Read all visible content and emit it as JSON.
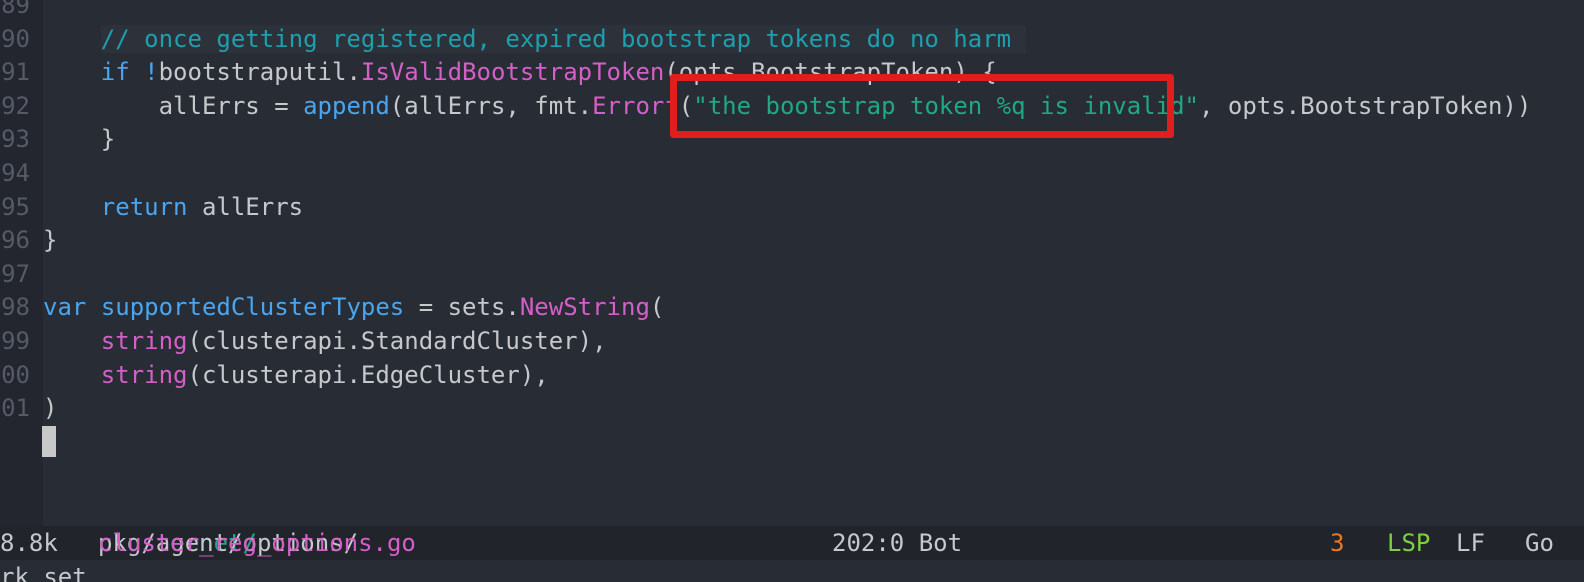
{
  "editor": {
    "lines": [
      {
        "num": "89",
        "tokens": []
      },
      {
        "num": "90",
        "tokens": [
          {
            "t": "    ",
            "c": "pl"
          },
          {
            "t": "// once getting registered, expired bootstrap tokens do no harm ",
            "c": "cm"
          }
        ]
      },
      {
        "num": "91",
        "tokens": [
          {
            "t": "    ",
            "c": "pl"
          },
          {
            "t": "if",
            "c": "kw"
          },
          {
            "t": " ",
            "c": "pl"
          },
          {
            "t": "!",
            "c": "op"
          },
          {
            "t": "bootstraputil.",
            "c": "pl"
          },
          {
            "t": "IsValidBootstrapToken",
            "c": "fn"
          },
          {
            "t": "(opts.BootstrapToken) {",
            "c": "pl"
          }
        ]
      },
      {
        "num": "92",
        "tokens": [
          {
            "t": "        allErrs = ",
            "c": "pl"
          },
          {
            "t": "append",
            "c": "kw"
          },
          {
            "t": "(allErrs, fmt.",
            "c": "pl"
          },
          {
            "t": "Errorf",
            "c": "fn"
          },
          {
            "t": "(",
            "c": "pl"
          },
          {
            "t": "\"the bootstrap token %q is invalid\"",
            "c": "str"
          },
          {
            "t": ", opts.BootstrapToken))",
            "c": "pl"
          }
        ]
      },
      {
        "num": "93",
        "tokens": [
          {
            "t": "    }",
            "c": "pl"
          }
        ]
      },
      {
        "num": "94",
        "tokens": []
      },
      {
        "num": "95",
        "tokens": [
          {
            "t": "    ",
            "c": "pl"
          },
          {
            "t": "return",
            "c": "kw"
          },
          {
            "t": " allErrs",
            "c": "pl"
          }
        ]
      },
      {
        "num": "96",
        "tokens": [
          {
            "t": "}",
            "c": "pl"
          }
        ]
      },
      {
        "num": "97",
        "tokens": []
      },
      {
        "num": "98",
        "tokens": [
          {
            "t": "var",
            "c": "kw"
          },
          {
            "t": " ",
            "c": "pl"
          },
          {
            "t": "supportedClusterTypes",
            "c": "kw"
          },
          {
            "t": " = sets.",
            "c": "pl"
          },
          {
            "t": "NewString",
            "c": "fn"
          },
          {
            "t": "(",
            "c": "pl"
          }
        ]
      },
      {
        "num": "99",
        "tokens": [
          {
            "t": "    ",
            "c": "pl"
          },
          {
            "t": "string",
            "c": "fn"
          },
          {
            "t": "(clusterapi.StandardCluster),",
            "c": "pl"
          }
        ]
      },
      {
        "num": "00",
        "tokens": [
          {
            "t": "    ",
            "c": "pl"
          },
          {
            "t": "string",
            "c": "fn"
          },
          {
            "t": "(clusterapi.EdgeCluster),",
            "c": "pl"
          }
        ]
      },
      {
        "num": "01",
        "tokens": [
          {
            "t": ")",
            "c": "pl"
          }
        ]
      }
    ]
  },
  "statusbar": {
    "size": "8.8k",
    "dir1": "clusternet/",
    "dir2": "pkg/agent/options/",
    "file": "cluster_reg_options.go",
    "position": "202:0 Bot",
    "errors": "3",
    "lsp": "LSP",
    "eol": "LF",
    "mode": "Go"
  },
  "echo_area": "rk set"
}
